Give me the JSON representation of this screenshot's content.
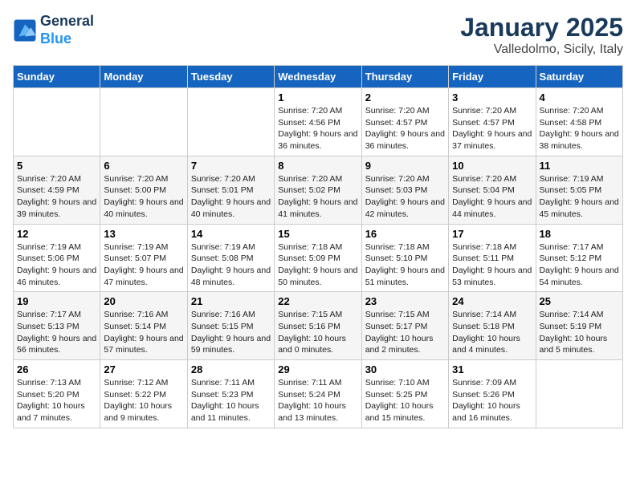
{
  "logo": {
    "line1": "General",
    "line2": "Blue"
  },
  "title": "January 2025",
  "location": "Valledolmo, Sicily, Italy",
  "weekdays": [
    "Sunday",
    "Monday",
    "Tuesday",
    "Wednesday",
    "Thursday",
    "Friday",
    "Saturday"
  ],
  "weeks": [
    [
      {
        "day": "",
        "info": ""
      },
      {
        "day": "",
        "info": ""
      },
      {
        "day": "",
        "info": ""
      },
      {
        "day": "1",
        "info": "Sunrise: 7:20 AM\nSunset: 4:56 PM\nDaylight: 9 hours and 36 minutes."
      },
      {
        "day": "2",
        "info": "Sunrise: 7:20 AM\nSunset: 4:57 PM\nDaylight: 9 hours and 36 minutes."
      },
      {
        "day": "3",
        "info": "Sunrise: 7:20 AM\nSunset: 4:57 PM\nDaylight: 9 hours and 37 minutes."
      },
      {
        "day": "4",
        "info": "Sunrise: 7:20 AM\nSunset: 4:58 PM\nDaylight: 9 hours and 38 minutes."
      }
    ],
    [
      {
        "day": "5",
        "info": "Sunrise: 7:20 AM\nSunset: 4:59 PM\nDaylight: 9 hours and 39 minutes."
      },
      {
        "day": "6",
        "info": "Sunrise: 7:20 AM\nSunset: 5:00 PM\nDaylight: 9 hours and 40 minutes."
      },
      {
        "day": "7",
        "info": "Sunrise: 7:20 AM\nSunset: 5:01 PM\nDaylight: 9 hours and 40 minutes."
      },
      {
        "day": "8",
        "info": "Sunrise: 7:20 AM\nSunset: 5:02 PM\nDaylight: 9 hours and 41 minutes."
      },
      {
        "day": "9",
        "info": "Sunrise: 7:20 AM\nSunset: 5:03 PM\nDaylight: 9 hours and 42 minutes."
      },
      {
        "day": "10",
        "info": "Sunrise: 7:20 AM\nSunset: 5:04 PM\nDaylight: 9 hours and 44 minutes."
      },
      {
        "day": "11",
        "info": "Sunrise: 7:19 AM\nSunset: 5:05 PM\nDaylight: 9 hours and 45 minutes."
      }
    ],
    [
      {
        "day": "12",
        "info": "Sunrise: 7:19 AM\nSunset: 5:06 PM\nDaylight: 9 hours and 46 minutes."
      },
      {
        "day": "13",
        "info": "Sunrise: 7:19 AM\nSunset: 5:07 PM\nDaylight: 9 hours and 47 minutes."
      },
      {
        "day": "14",
        "info": "Sunrise: 7:19 AM\nSunset: 5:08 PM\nDaylight: 9 hours and 48 minutes."
      },
      {
        "day": "15",
        "info": "Sunrise: 7:18 AM\nSunset: 5:09 PM\nDaylight: 9 hours and 50 minutes."
      },
      {
        "day": "16",
        "info": "Sunrise: 7:18 AM\nSunset: 5:10 PM\nDaylight: 9 hours and 51 minutes."
      },
      {
        "day": "17",
        "info": "Sunrise: 7:18 AM\nSunset: 5:11 PM\nDaylight: 9 hours and 53 minutes."
      },
      {
        "day": "18",
        "info": "Sunrise: 7:17 AM\nSunset: 5:12 PM\nDaylight: 9 hours and 54 minutes."
      }
    ],
    [
      {
        "day": "19",
        "info": "Sunrise: 7:17 AM\nSunset: 5:13 PM\nDaylight: 9 hours and 56 minutes."
      },
      {
        "day": "20",
        "info": "Sunrise: 7:16 AM\nSunset: 5:14 PM\nDaylight: 9 hours and 57 minutes."
      },
      {
        "day": "21",
        "info": "Sunrise: 7:16 AM\nSunset: 5:15 PM\nDaylight: 9 hours and 59 minutes."
      },
      {
        "day": "22",
        "info": "Sunrise: 7:15 AM\nSunset: 5:16 PM\nDaylight: 10 hours and 0 minutes."
      },
      {
        "day": "23",
        "info": "Sunrise: 7:15 AM\nSunset: 5:17 PM\nDaylight: 10 hours and 2 minutes."
      },
      {
        "day": "24",
        "info": "Sunrise: 7:14 AM\nSunset: 5:18 PM\nDaylight: 10 hours and 4 minutes."
      },
      {
        "day": "25",
        "info": "Sunrise: 7:14 AM\nSunset: 5:19 PM\nDaylight: 10 hours and 5 minutes."
      }
    ],
    [
      {
        "day": "26",
        "info": "Sunrise: 7:13 AM\nSunset: 5:20 PM\nDaylight: 10 hours and 7 minutes."
      },
      {
        "day": "27",
        "info": "Sunrise: 7:12 AM\nSunset: 5:22 PM\nDaylight: 10 hours and 9 minutes."
      },
      {
        "day": "28",
        "info": "Sunrise: 7:11 AM\nSunset: 5:23 PM\nDaylight: 10 hours and 11 minutes."
      },
      {
        "day": "29",
        "info": "Sunrise: 7:11 AM\nSunset: 5:24 PM\nDaylight: 10 hours and 13 minutes."
      },
      {
        "day": "30",
        "info": "Sunrise: 7:10 AM\nSunset: 5:25 PM\nDaylight: 10 hours and 15 minutes."
      },
      {
        "day": "31",
        "info": "Sunrise: 7:09 AM\nSunset: 5:26 PM\nDaylight: 10 hours and 16 minutes."
      },
      {
        "day": "",
        "info": ""
      }
    ]
  ]
}
